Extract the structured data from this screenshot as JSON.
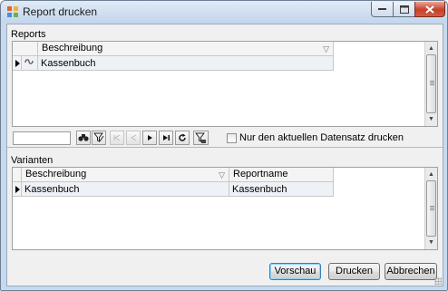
{
  "window": {
    "title": "Report drucken",
    "icon": "report-app-icon"
  },
  "reports": {
    "group_label": "Reports",
    "columns": [
      "Beschreibung"
    ],
    "rows": [
      {
        "icon": "report-link-icon",
        "cells": [
          "Kassenbuch"
        ]
      }
    ]
  },
  "toolbar": {
    "search_value": "",
    "buttons": [
      {
        "icon": "binoculars-icon",
        "enabled": true
      },
      {
        "icon": "filter-edit-icon",
        "enabled": true
      },
      {
        "icon": "first-record-icon",
        "enabled": false
      },
      {
        "icon": "prev-record-icon",
        "enabled": false
      },
      {
        "icon": "next-record-icon",
        "enabled": true
      },
      {
        "icon": "last-record-icon",
        "enabled": true
      },
      {
        "icon": "refresh-icon",
        "enabled": true
      },
      {
        "icon": "filter-apply-icon",
        "enabled": true
      }
    ],
    "checkbox_label": "Nur den aktuellen Datensatz drucken",
    "checkbox_checked": false
  },
  "variants": {
    "group_label": "Varianten",
    "columns": [
      "Beschreibung",
      "Reportname"
    ],
    "rows": [
      {
        "cells": [
          "Kassenbuch",
          "Kassenbuch"
        ]
      }
    ]
  },
  "buttons": {
    "preview": "Vorschau",
    "print": "Drucken",
    "cancel": "Abbrechen"
  }
}
